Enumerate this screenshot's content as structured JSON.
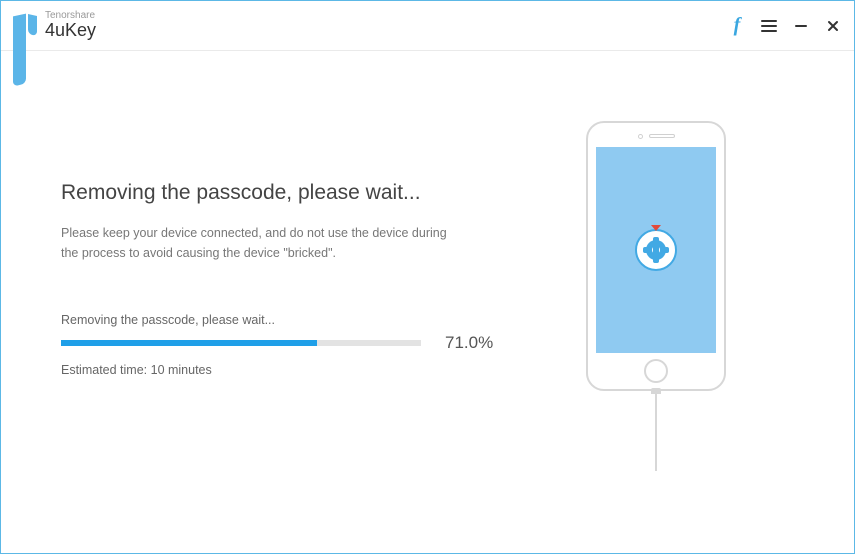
{
  "header": {
    "brand": "Tenorshare",
    "product": "4uKey"
  },
  "main": {
    "heading": "Removing the passcode, please wait...",
    "description": "Please keep your device connected, and do not use the device during the process to avoid causing the device \"bricked\".",
    "progress_label": "Removing the passcode, please wait...",
    "percent_text": "71.0%",
    "percent_value": 71.0,
    "estimate": "Estimated time: 10 minutes"
  },
  "colors": {
    "accent": "#1f9fe8",
    "window_border": "#5cb8e6",
    "phone_screen": "#8fcaf1"
  }
}
